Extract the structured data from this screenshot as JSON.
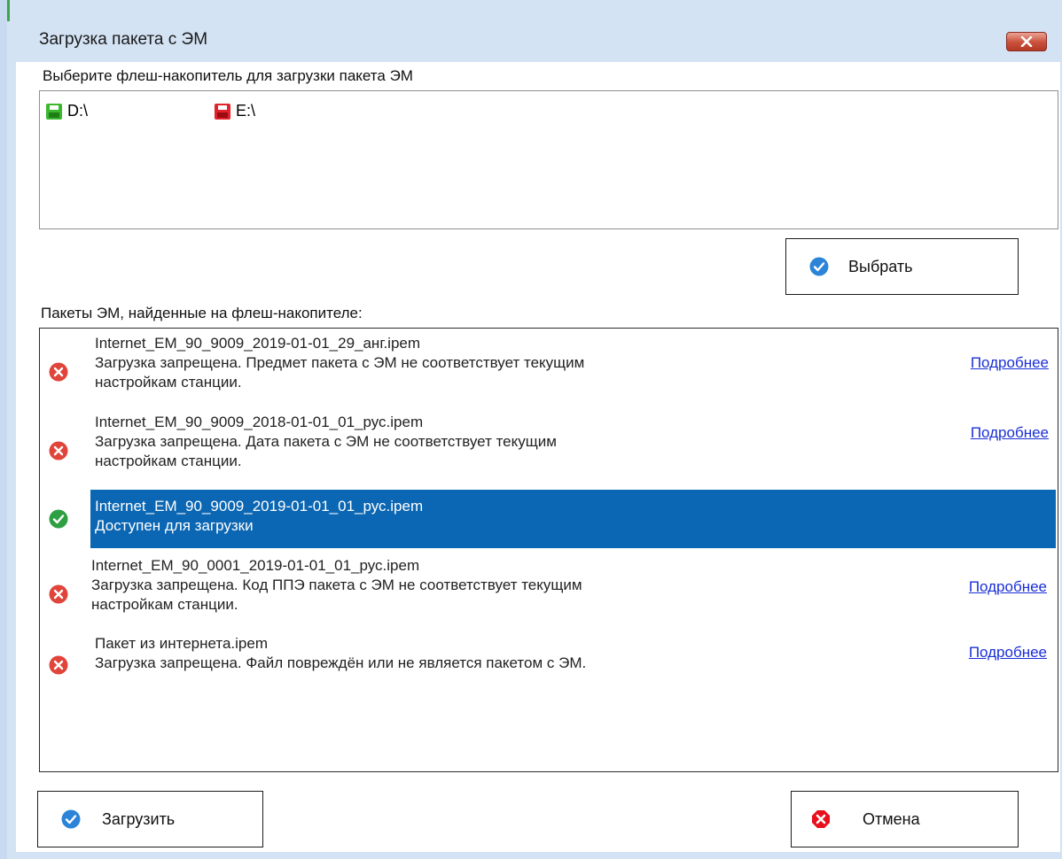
{
  "window": {
    "title": "Загрузка пакета с ЭМ"
  },
  "drives": {
    "label": "Выберите флеш-накопитель для загрузки пакета ЭМ",
    "items": [
      {
        "name": "D:\\",
        "color": "#3cb82e"
      },
      {
        "name": "E:\\",
        "color": "#e2212b"
      }
    ]
  },
  "select_button": {
    "label": "Выбрать"
  },
  "packages": {
    "label": "Пакеты ЭМ, найденные на флеш-накопителе:",
    "items": [
      {
        "file": "Internet_EM_90_9009_2019-01-01_29_анг.ipem",
        "line2": "Загрузка запрещена. Предмет пакета с ЭМ не соответствует текущим",
        "line3": "настройкам станции.",
        "link": "Подробнее",
        "status": "error"
      },
      {
        "file": "Internet_EM_90_9009_2018-01-01_01_рус.ipem",
        "line2": "Загрузка запрещена. Дата пакета с ЭМ не соответствует текущим",
        "line3": "настройкам станции.",
        "link": "Подробнее",
        "status": "error"
      },
      {
        "file": "Internet_EM_90_9009_2019-01-01_01_рус.ipem",
        "line2": "Доступен для загрузки",
        "status": "ok",
        "selected": true
      },
      {
        "file": "Internet_EM_90_0001_2019-01-01_01_рус.ipem",
        "line2": "Загрузка запрещена. Код ППЭ пакета с ЭМ не соответствует текущим",
        "line3": "настройкам станции.",
        "link": "Подробнее",
        "status": "error"
      },
      {
        "file": "Пакет из интернета.ipem",
        "line2": "Загрузка запрещена. Файл повреждён или не является пакетом с ЭМ.",
        "link": "Подробнее",
        "status": "error"
      }
    ]
  },
  "load_button": {
    "label": "Загрузить"
  },
  "cancel_button": {
    "label": "Отмена"
  },
  "colors": {
    "accent": "#0b66b3",
    "link": "#1a2fd6",
    "error": "#e0443a",
    "ok": "#2ea043",
    "check_blue": "#2b84d8",
    "cancel_red": "#e8101c"
  }
}
